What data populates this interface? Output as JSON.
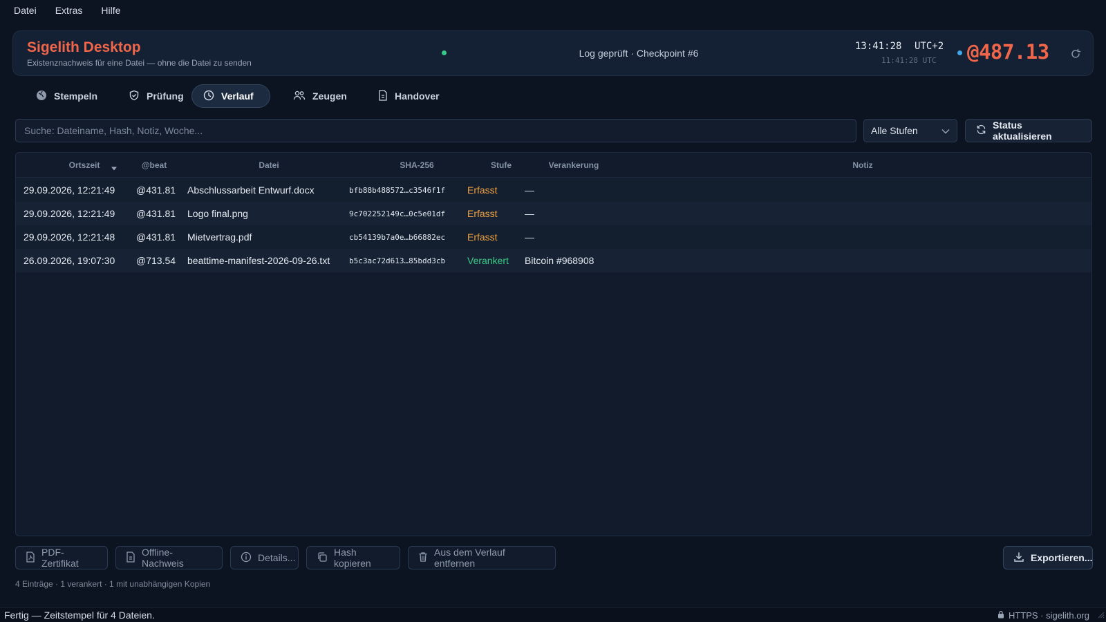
{
  "menu": [
    {
      "label": "Datei"
    },
    {
      "label": "Extras"
    },
    {
      "label": "Hilfe"
    }
  ],
  "header": {
    "title": "Sigelith Desktop",
    "subtitle": "Existenznachweis für eine Datei — ohne die Datei zu senden",
    "log_status": "Log geprüft · Checkpoint #6",
    "local_time": "13:41:28",
    "timezone": "UTC+2",
    "utc_time": "11:41:28 UTC",
    "beat": "@487.13"
  },
  "tabs": [
    {
      "label": "Stempeln",
      "icon": "globe-icon",
      "active": false
    },
    {
      "label": "Prüfung",
      "icon": "shield-icon",
      "active": false
    },
    {
      "label": "Verlauf",
      "icon": "clock-icon",
      "active": true
    },
    {
      "label": "Zeugen",
      "icon": "users-icon",
      "active": false
    },
    {
      "label": "Handover",
      "icon": "document-icon",
      "active": false
    }
  ],
  "search": {
    "placeholder": "Suche: Dateiname, Hash, Notiz, Woche...",
    "value": ""
  },
  "filter": {
    "selected": "Alle Stufen"
  },
  "refresh_button": "Status aktualisieren",
  "table": {
    "columns": [
      "Ortszeit",
      "@beat",
      "Datei",
      "SHA-256",
      "Stufe",
      "Verankerung",
      "Notiz"
    ],
    "rows": [
      {
        "time": "29.09.2026, 12:21:49",
        "beat": "@431.81",
        "file": "Abschlussarbeit Entwurf.docx",
        "hash": "bfb88b488572…c3546f1f",
        "stage": "Erfasst",
        "anchor": "—",
        "note": ""
      },
      {
        "time": "29.09.2026, 12:21:49",
        "beat": "@431.81",
        "file": "Logo final.png",
        "hash": "9c702252149c…0c5e01df",
        "stage": "Erfasst",
        "anchor": "—",
        "note": ""
      },
      {
        "time": "29.09.2026, 12:21:48",
        "beat": "@431.81",
        "file": "Mietvertrag.pdf",
        "hash": "cb54139b7a0e…b66882ec",
        "stage": "Erfasst",
        "anchor": "—",
        "note": ""
      },
      {
        "time": "26.09.2026, 19:07:30",
        "beat": "@713.54",
        "file": "beattime-manifest-2026-09-26.txt",
        "hash": "b5c3ac72d613…85bdd3cb",
        "stage": "Verankert",
        "anchor": "Bitcoin #968908",
        "note": ""
      }
    ]
  },
  "actions": [
    {
      "label": "PDF-Zertifikat",
      "icon": "pdf-icon"
    },
    {
      "label": "Offline-Nachweis",
      "icon": "document-icon"
    },
    {
      "label": "Details...",
      "icon": "info-icon"
    },
    {
      "label": "Hash kopieren",
      "icon": "copy-icon"
    },
    {
      "label": "Aus dem Verlauf entfernen",
      "icon": "trash-icon"
    }
  ],
  "export_button": "Exportieren...",
  "summary": "4 Einträge · 1 verankert · 1 mit unabhängigen Kopien",
  "statusbar": {
    "left": "Fertig — Zeitstempel für 4 Dateien.",
    "right": "HTTPS · sigelith.org"
  },
  "colors": {
    "accent": "#f0664a",
    "stage_erfasst": "#f0a340",
    "stage_verankert": "#3ccb86",
    "background": "#0d1421"
  }
}
